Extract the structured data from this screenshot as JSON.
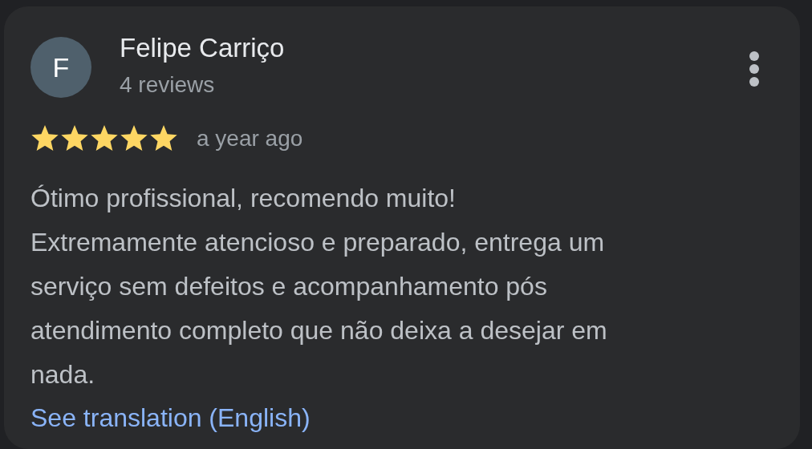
{
  "review": {
    "avatar_letter": "F",
    "author": "Felipe Carriço",
    "author_meta": "4 reviews",
    "stars": 5,
    "time": "a year ago",
    "text": "Ótimo profissional, recomendo muito!\nExtremamente atencioso e preparado, entrega um serviço sem defeitos e acompanhamento pós atendimento completo que não deixa a desejar em nada.",
    "translate_link": "See translation (English)"
  }
}
